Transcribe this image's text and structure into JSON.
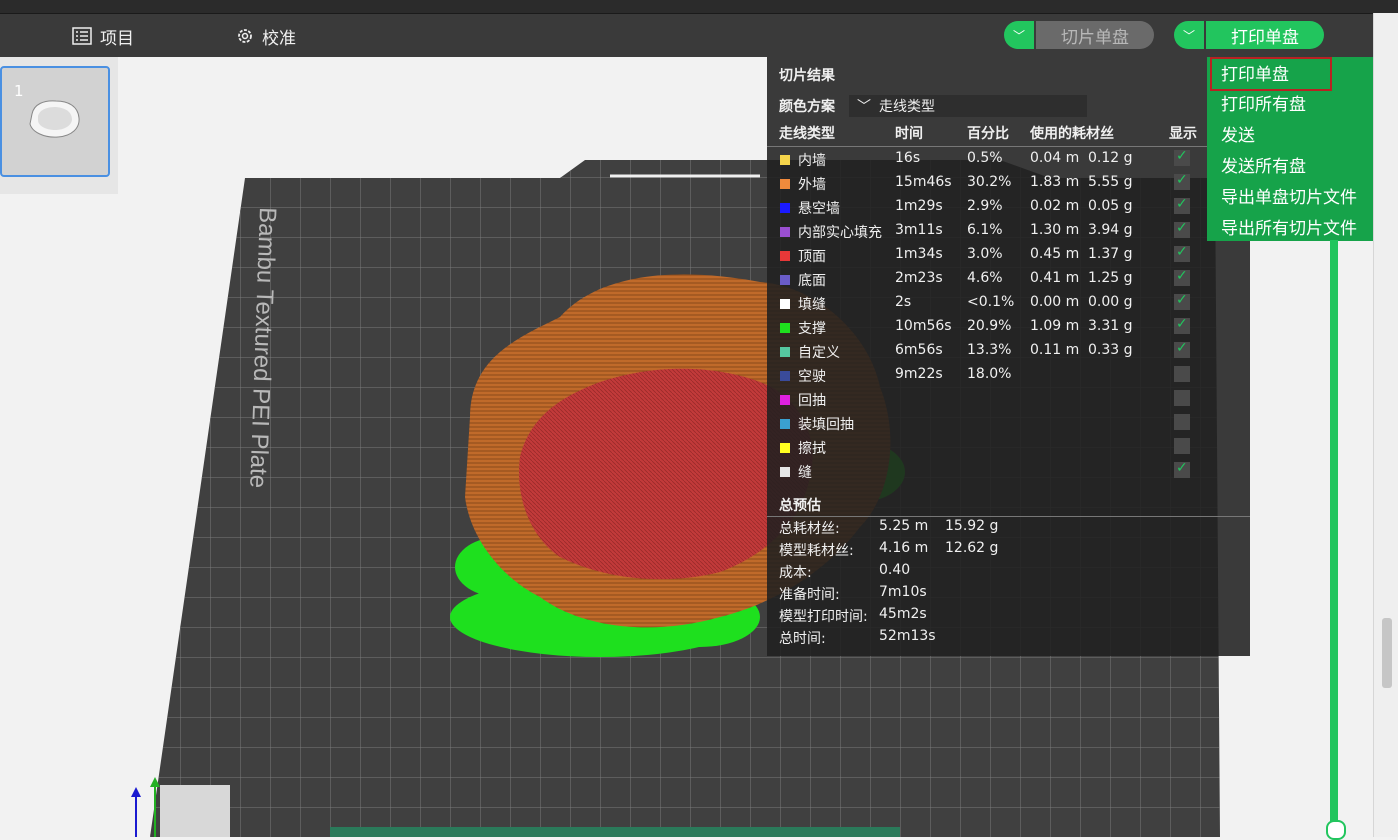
{
  "toolbar": {
    "project_label": "项目",
    "calibrate_label": "校准",
    "slice_label": "切片单盘",
    "print_label": "打印单盘"
  },
  "thumbnail": {
    "plate_number": "1"
  },
  "bed": {
    "label": "Bambu Textured PEI Plate"
  },
  "dropdown": {
    "items": [
      "打印单盘",
      "打印所有盘",
      "发送",
      "发送所有盘",
      "导出单盘切片文件",
      "导出所有切片文件"
    ]
  },
  "panel": {
    "title": "切片结果",
    "scheme_label": "颜色方案",
    "scheme_value": "走线类型",
    "headers": {
      "type": "走线类型",
      "time": "时间",
      "percent": "百分比",
      "used": "使用的耗材丝",
      "show": "显示"
    },
    "rows": [
      {
        "name": "内墙",
        "color": "#f5d44b",
        "time": "16s",
        "pct": "0.5%",
        "m": "0.04 m",
        "g": "0.12 g",
        "show": true
      },
      {
        "name": "外墙",
        "color": "#f08a3c",
        "time": "15m46s",
        "pct": "30.2%",
        "m": "1.83 m",
        "g": "5.55 g",
        "show": true
      },
      {
        "name": "悬空墙",
        "color": "#1a1aff",
        "time": "1m29s",
        "pct": "2.9%",
        "m": "0.02 m",
        "g": "0.05 g",
        "show": true
      },
      {
        "name": "内部实心填充",
        "color": "#9a4fd1",
        "time": "3m11s",
        "pct": "6.1%",
        "m": "1.30 m",
        "g": "3.94 g",
        "show": true
      },
      {
        "name": "顶面",
        "color": "#e83838",
        "time": "1m34s",
        "pct": "3.0%",
        "m": "0.45 m",
        "g": "1.37 g",
        "show": true
      },
      {
        "name": "底面",
        "color": "#6a5cc8",
        "time": "2m23s",
        "pct": "4.6%",
        "m": "0.41 m",
        "g": "1.25 g",
        "show": true
      },
      {
        "name": "填缝",
        "color": "#ffffff",
        "time": "2s",
        "pct": "<0.1%",
        "m": "0.00 m",
        "g": "0.00 g",
        "show": true
      },
      {
        "name": "支撑",
        "color": "#1ee01e",
        "time": "10m56s",
        "pct": "20.9%",
        "m": "1.09 m",
        "g": "3.31 g",
        "show": true
      },
      {
        "name": "自定义",
        "color": "#55c7a0",
        "time": "6m56s",
        "pct": "13.3%",
        "m": "0.11 m",
        "g": "0.33 g",
        "show": true
      },
      {
        "name": "空驶",
        "color": "#3a4b9a",
        "time": "9m22s",
        "pct": "18.0%",
        "m": "",
        "g": "",
        "show": false
      },
      {
        "name": "回抽",
        "color": "#e020e0",
        "time": "",
        "pct": "",
        "m": "",
        "g": "",
        "show": false
      },
      {
        "name": "装填回抽",
        "color": "#3aa0d0",
        "time": "",
        "pct": "",
        "m": "",
        "g": "",
        "show": false
      },
      {
        "name": "擦拭",
        "color": "#ffff20",
        "time": "",
        "pct": "",
        "m": "",
        "g": "",
        "show": false
      },
      {
        "name": "缝",
        "color": "#e6e6e6",
        "time": "",
        "pct": "",
        "m": "",
        "g": "",
        "show": true
      }
    ],
    "estimate": {
      "title": "总预估",
      "rows": [
        {
          "label": "总耗材丝:",
          "v1": "5.25 m",
          "v2": "15.92 g"
        },
        {
          "label": "模型耗材丝:",
          "v1": "4.16 m",
          "v2": "12.62 g"
        },
        {
          "label": "成本:",
          "v1": "0.40",
          "v2": ""
        },
        {
          "label": "准备时间:",
          "v1": "7m10s",
          "v2": ""
        },
        {
          "label": "模型打印时间:",
          "v1": "45m2s",
          "v2": ""
        },
        {
          "label": "总时间:",
          "v1": "52m13s",
          "v2": ""
        }
      ]
    }
  }
}
